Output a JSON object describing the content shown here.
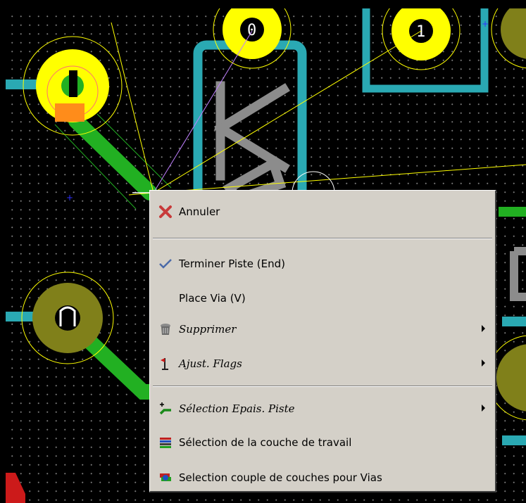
{
  "pcb": {
    "pads": [
      {
        "label": "0"
      },
      {
        "label": "1"
      }
    ]
  },
  "context_menu": {
    "items": [
      {
        "label": "Annuler",
        "icon": "cancel-x-icon",
        "submenu": false
      },
      {
        "label": "Terminer Piste (End)",
        "icon": "checkmark-icon",
        "submenu": false
      },
      {
        "label": "Place Via (V)",
        "icon": "",
        "submenu": false
      },
      {
        "label": "Supprimer",
        "icon": "delete-bin-icon",
        "submenu": true
      },
      {
        "label": "Ajust. Flags",
        "icon": "flag-icon",
        "submenu": true
      },
      {
        "label": "Sélection Epais. Piste",
        "icon": "track-width-icon",
        "submenu": true
      },
      {
        "label": "Sélection de la couche de travail",
        "icon": "layer-stack-icon",
        "submenu": false
      },
      {
        "label": "Selection couple de couches pour Vias",
        "icon": "via-layer-pair-icon",
        "submenu": false
      }
    ]
  },
  "colors": {
    "pad_yellow": "#ffff00",
    "pad_olive": "#80801a",
    "track_green": "#22b022",
    "outline_cyan": "#2aa9b3",
    "silkscreen_gray": "#8c8c8c",
    "menu_bg": "#d4d0c8"
  }
}
